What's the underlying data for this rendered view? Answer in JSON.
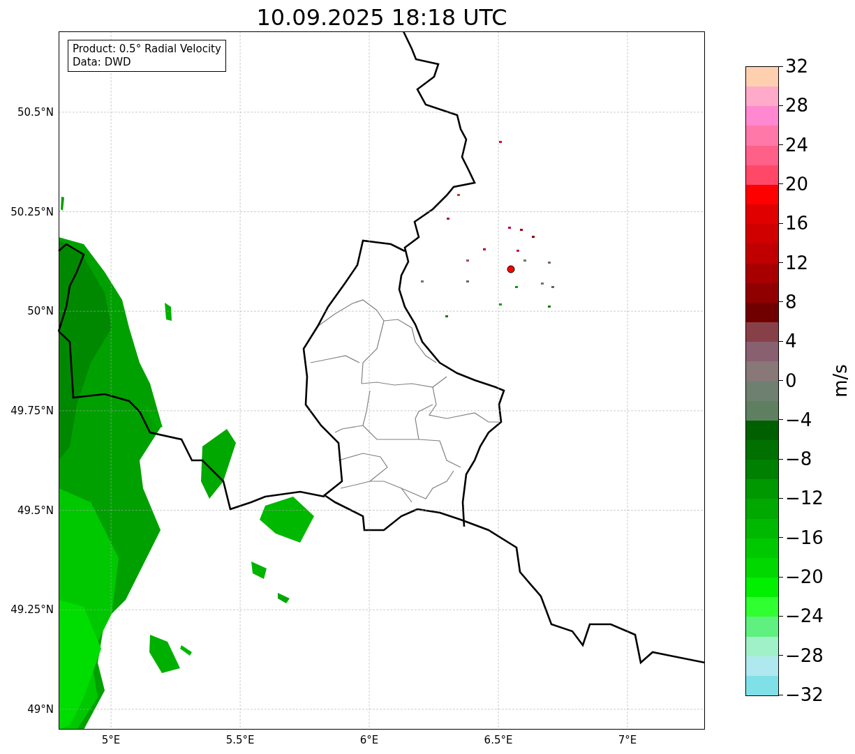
{
  "title": "10.09.2025 18:18 UTC",
  "map": {
    "lon_ticks": [
      {
        "label": "5°E"
      },
      {
        "label": "5.5°E"
      },
      {
        "label": "6°E"
      },
      {
        "label": "6.5°E"
      },
      {
        "label": "7°E"
      }
    ],
    "lat_ticks": [
      {
        "label": "50.5°N"
      },
      {
        "label": "50.25°N"
      },
      {
        "label": "50°N"
      },
      {
        "label": "49.75°N"
      },
      {
        "label": "49.5°N"
      },
      {
        "label": "49.25°N"
      },
      {
        "label": "49°N"
      }
    ],
    "legend": [
      "Product: 0.5° Radial Velocity",
      "Data: DWD"
    ]
  },
  "colorbar": {
    "label": "m/s",
    "ticks": [
      "32",
      "28",
      "24",
      "20",
      "16",
      "12",
      "8",
      "4",
      "0",
      "−4",
      "−8",
      "−12",
      "−16",
      "−20",
      "−24",
      "−28",
      "−32"
    ],
    "bands": [
      {
        "color": "#ffd0b0"
      },
      {
        "color": "#ffaac8"
      },
      {
        "color": "#ff88d0"
      },
      {
        "color": "#ff78a8"
      },
      {
        "color": "#ff6088"
      },
      {
        "color": "#ff4868"
      },
      {
        "color": "#ff0000"
      },
      {
        "color": "#e00000"
      },
      {
        "color": "#d00000"
      },
      {
        "color": "#c00000"
      },
      {
        "color": "#a80000"
      },
      {
        "color": "#900000"
      },
      {
        "color": "#700000"
      },
      {
        "color": "#884048"
      },
      {
        "color": "#886070"
      },
      {
        "color": "#887878"
      },
      {
        "color": "#6e8070"
      },
      {
        "color": "#5e8060"
      },
      {
        "color": "#006000"
      },
      {
        "color": "#007000"
      },
      {
        "color": "#008000"
      },
      {
        "color": "#009800"
      },
      {
        "color": "#00a800"
      },
      {
        "color": "#00b800"
      },
      {
        "color": "#00c800"
      },
      {
        "color": "#00d800"
      },
      {
        "color": "#00f000"
      },
      {
        "color": "#30ff30"
      },
      {
        "color": "#60f080"
      },
      {
        "color": "#a0f0c8"
      },
      {
        "color": "#b0e8f0"
      },
      {
        "color": "#80e0e8"
      }
    ]
  }
}
